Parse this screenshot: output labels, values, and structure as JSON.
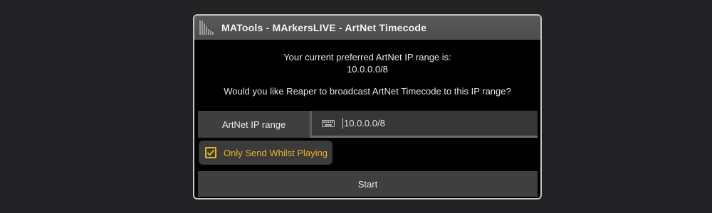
{
  "window": {
    "title": "MATools - MArkersLIVE - ArtNet Timecode",
    "icon": "matools-logo-icon"
  },
  "message": {
    "line1": "Your current preferred ArtNet IP range is:",
    "line2": "10.0.0.0/8",
    "line3": "Would you like Reaper to broadcast ArtNet Timecode to this IP range?"
  },
  "ip_field": {
    "label": "ArtNet IP range",
    "value": "10.0.0.0/8",
    "icon": "keyboard-icon"
  },
  "checkbox": {
    "label": "Only Send Whilst Playing",
    "checked": true,
    "accent_color": "#e6b51e"
  },
  "start_button": {
    "label": "Start"
  }
}
